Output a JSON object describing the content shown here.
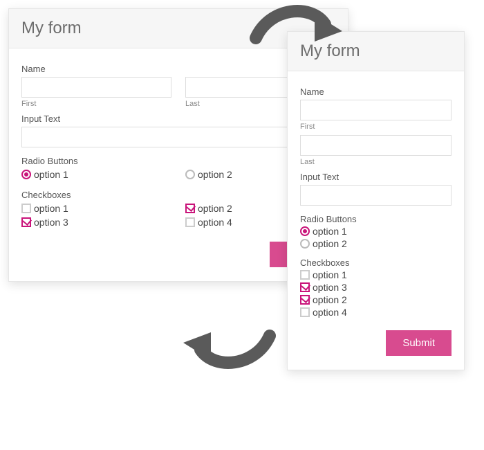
{
  "title": "My form",
  "name": {
    "label": "Name",
    "first_sub": "First",
    "last_sub": "Last"
  },
  "input_text_label": "Input Text",
  "radio": {
    "group_label": "Radio Buttons",
    "options": [
      "option 1",
      "option 2"
    ],
    "selected": "option 1"
  },
  "checkbox": {
    "group_label": "Checkboxes"
  },
  "wide_checkbox_order": [
    "option 1",
    "option 2",
    "option 3",
    "option 4"
  ],
  "narrow_checkbox_order": [
    "option 1",
    "option 3",
    "option 2",
    "option 4"
  ],
  "checkbox_checked": [
    "option 2",
    "option 3"
  ],
  "submit_label": "Submit"
}
